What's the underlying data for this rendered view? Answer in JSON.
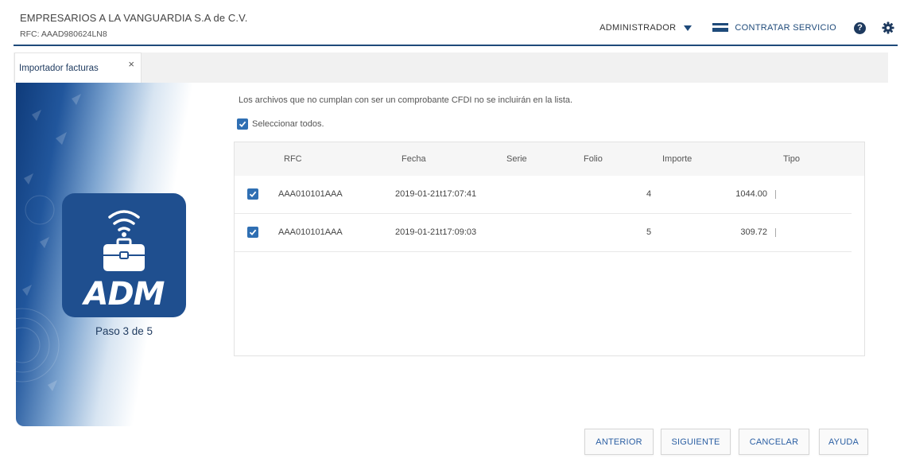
{
  "header": {
    "company_name": "EMPRESARIOS A LA VANGUARDIA S.A de C.V.",
    "rfc": "RFC: AAAD980624LN8",
    "user_label": "ADMINISTRADOR",
    "service_label": "CONTRATAR SERVICIO",
    "help_icon": "question-circle-icon",
    "settings_icon": "gear-icon"
  },
  "tabs": [
    {
      "label": "Importador facturas",
      "close": "×"
    }
  ],
  "left_panel": {
    "logo_text": "ADM",
    "logo_icon": "briefcase-wifi-icon",
    "step_text": "Paso 3 de 5"
  },
  "main": {
    "info_text": "Los archivos que no cumplan con ser un comprobante CFDI no se incluirán en la lista.",
    "select_all_label": "Seleccionar todos.",
    "select_all_checked": true,
    "columns": [
      "RFC",
      "Fecha",
      "Serie",
      "Folio",
      "Importe",
      "Tipo"
    ],
    "rows": [
      {
        "checked": true,
        "rfc": "AAA010101AAA",
        "fecha": "2019-01-21t17:07:41",
        "serie": "",
        "folio": "4",
        "importe": "1044.00",
        "tipo": "I"
      },
      {
        "checked": true,
        "rfc": "AAA010101AAA",
        "fecha": "2019-01-21t17:09:03",
        "serie": "",
        "folio": "5",
        "importe": "309.72",
        "tipo": "I"
      }
    ]
  },
  "buttons": {
    "anterior": "ANTERIOR",
    "siguiente": "SIGUIENTE",
    "cancelar": "CANCELAR",
    "ayuda": "AYUDA"
  },
  "colors": {
    "primary": "#1e4a7a",
    "logo_bg": "#1f4f8f",
    "checkbox": "#2f6fb3",
    "button_text": "#2b5fa3"
  }
}
